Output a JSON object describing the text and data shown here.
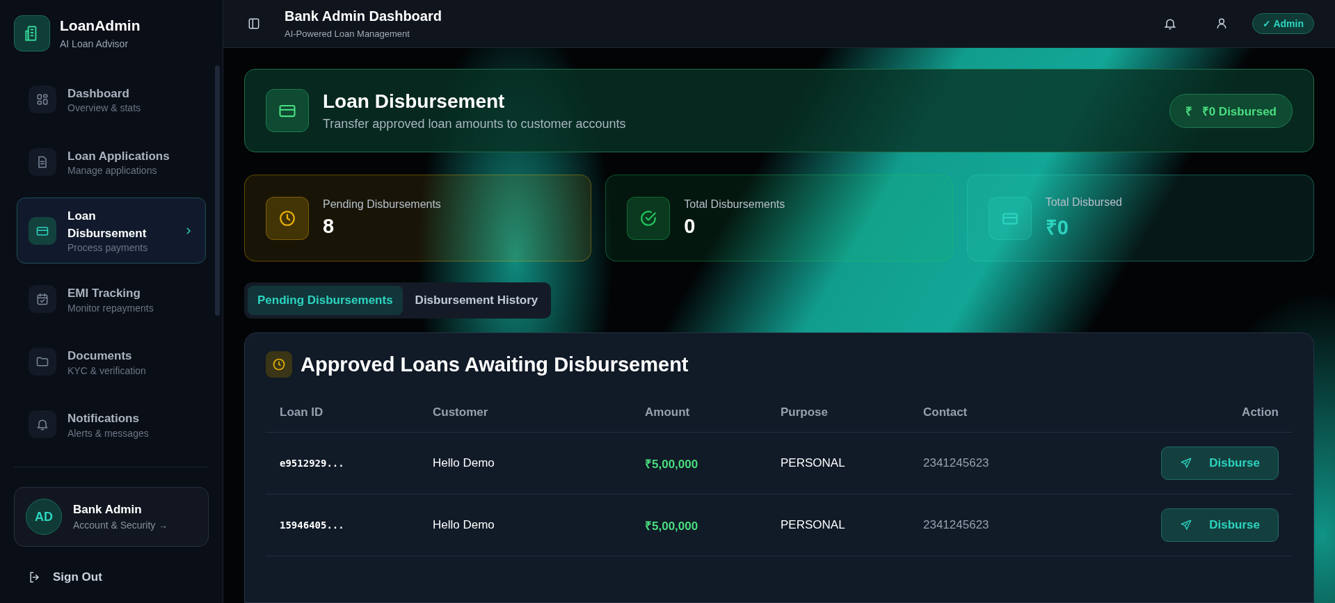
{
  "brand": {
    "name": "LoanAdmin",
    "tagline": "AI Loan Advisor"
  },
  "nav": [
    {
      "kind": "dashboard",
      "label": "Dashboard",
      "sub": "Overview & stats",
      "selected": false
    },
    {
      "kind": "applications",
      "label": "Loan Applications",
      "sub": "Manage applications",
      "selected": false
    },
    {
      "kind": "disbursement",
      "label": "Loan Disbursement",
      "sub": "Process payments",
      "selected": true
    },
    {
      "kind": "emi",
      "label": "EMI Tracking",
      "sub": "Monitor repayments",
      "selected": false
    },
    {
      "kind": "documents",
      "label": "Documents",
      "sub": "KYC & verification",
      "selected": false
    },
    {
      "kind": "notifications",
      "label": "Notifications",
      "sub": "Alerts & messages",
      "selected": false
    }
  ],
  "profile": {
    "initials": "AD",
    "name": "Bank Admin",
    "sub": "Account & Security →"
  },
  "sign_out": "Sign Out",
  "header": {
    "title": "Bank Admin Dashboard",
    "subtitle": "AI-Powered Loan Management",
    "badge": "✓ Admin"
  },
  "hero": {
    "title": "Loan Disbursement",
    "subtitle": "Transfer approved loan amounts to customer accounts",
    "pill_icon": "₹",
    "pill": "₹0 Disbursed"
  },
  "stats": [
    {
      "kind": "pending",
      "color": "#eab308",
      "label": "Pending Disbursements",
      "value": "8"
    },
    {
      "kind": "done",
      "color": "#22c55e",
      "label": "Total Disbursements",
      "value": "0"
    },
    {
      "kind": "total",
      "color": "#2dd4bf",
      "label": "Total Disbursed",
      "value": "₹0"
    }
  ],
  "tabs": [
    {
      "label": "Pending Disbursements",
      "selected": true
    },
    {
      "label": "Disbursement History",
      "selected": false
    }
  ],
  "table": {
    "title": "Approved Loans Awaiting Disbursement",
    "columns": [
      "Loan ID",
      "Customer",
      "Amount",
      "Purpose",
      "Contact",
      "Action"
    ],
    "rows": [
      {
        "id": "e9512929...",
        "customer": "Hello Demo",
        "amount": "₹5,00,000",
        "purpose": "PERSONAL",
        "contact": "2341245623",
        "action": "Disburse"
      },
      {
        "id": "15946405...",
        "customer": "Hello Demo",
        "amount": "₹5,00,000",
        "purpose": "PERSONAL",
        "contact": "2341245623",
        "action": "Disburse"
      }
    ]
  }
}
